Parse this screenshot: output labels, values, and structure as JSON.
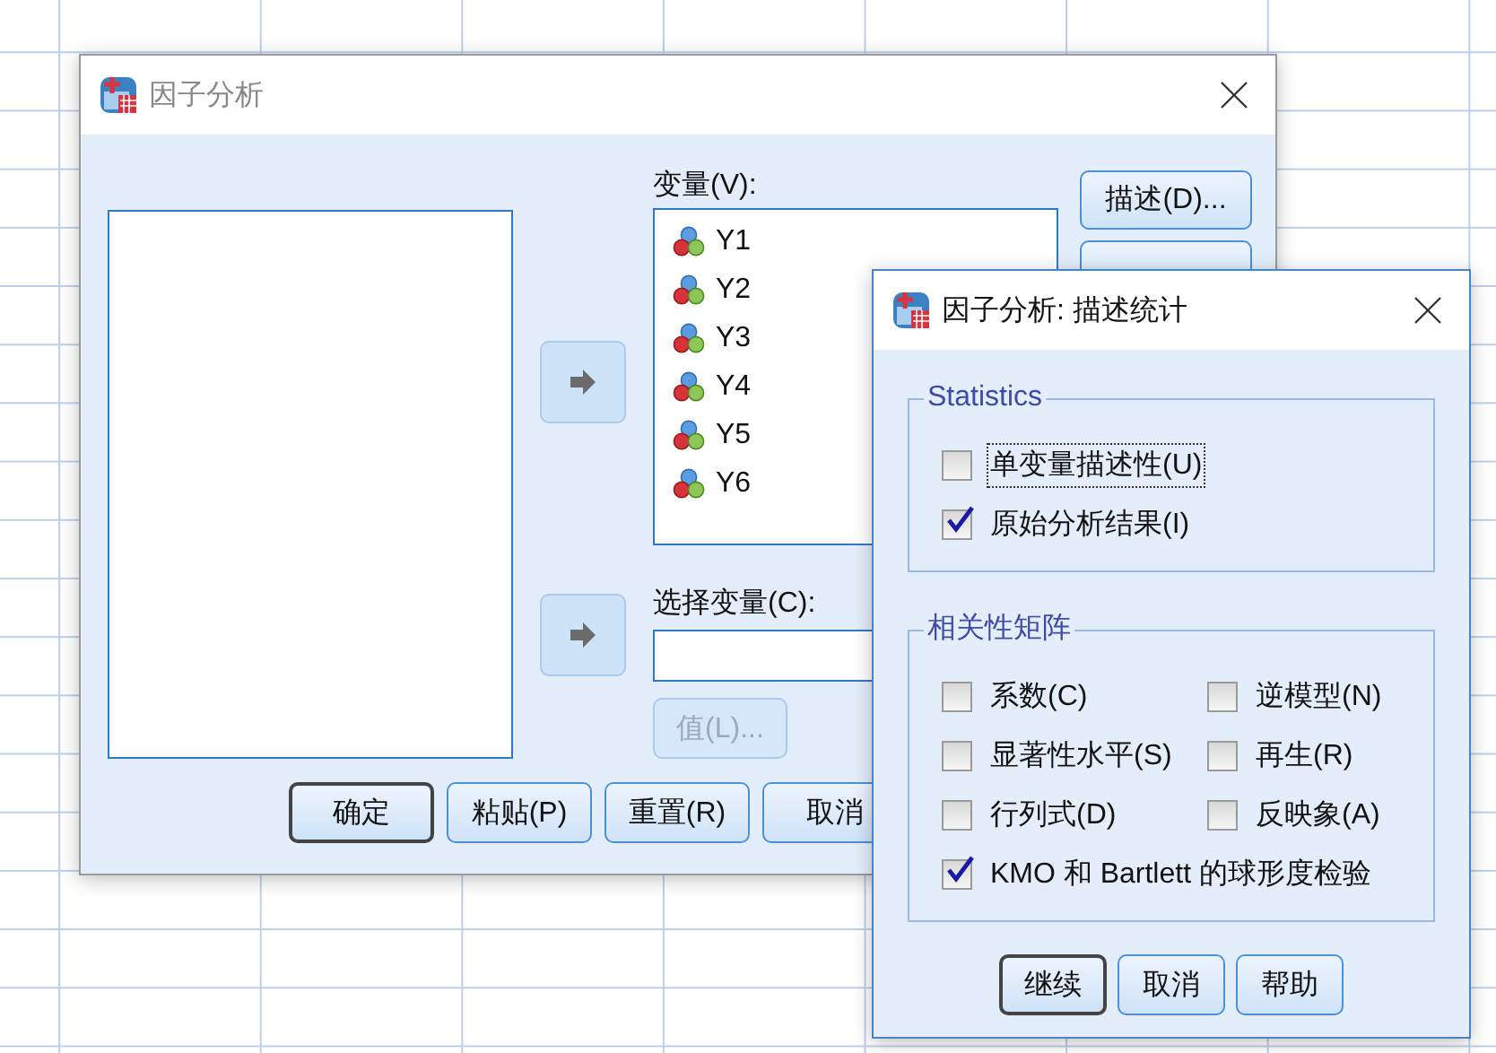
{
  "main_dialog": {
    "title": "因子分析",
    "variables_label": "变量(V):",
    "variables": [
      {
        "name": "Y1"
      },
      {
        "name": "Y2"
      },
      {
        "name": "Y3"
      },
      {
        "name": "Y4"
      },
      {
        "name": "Y5"
      },
      {
        "name": "Y6"
      }
    ],
    "side_buttons": [
      {
        "label": "描述(D)..."
      }
    ],
    "selection_label": "选择变量(C):",
    "value_button": {
      "label": "值(L)...",
      "disabled": true
    },
    "buttons": [
      {
        "label": "确定",
        "default": true
      },
      {
        "label": "粘贴(P)",
        "default": false
      },
      {
        "label": "重置(R)",
        "default": false
      },
      {
        "label": "取消",
        "default": false
      }
    ]
  },
  "sub_dialog": {
    "title": "因子分析: 描述统计",
    "groups": [
      {
        "title": "Statistics",
        "rows": [
          [
            {
              "label": "单变量描述性(U)",
              "checked": false,
              "focused": true
            }
          ],
          [
            {
              "label": "原始分析结果(I)",
              "checked": true,
              "focused": false
            }
          ]
        ]
      },
      {
        "title": "相关性矩阵",
        "rows": [
          [
            {
              "label": "系数(C)",
              "checked": false,
              "focused": false
            },
            {
              "label": "逆模型(N)",
              "checked": false,
              "focused": false
            }
          ],
          [
            {
              "label": "显著性水平(S)",
              "checked": false,
              "focused": false
            },
            {
              "label": "再生(R)",
              "checked": false,
              "focused": false
            }
          ],
          [
            {
              "label": "行列式(D)",
              "checked": false,
              "focused": false
            },
            {
              "label": "反映象(A)",
              "checked": false,
              "focused": false
            }
          ],
          [
            {
              "label": "KMO 和 Bartlett 的球形度检验",
              "checked": true,
              "focused": false
            }
          ]
        ]
      }
    ],
    "buttons": [
      {
        "label": "继续",
        "default": true
      },
      {
        "label": "取消",
        "default": false
      },
      {
        "label": "帮助",
        "default": false
      }
    ]
  }
}
